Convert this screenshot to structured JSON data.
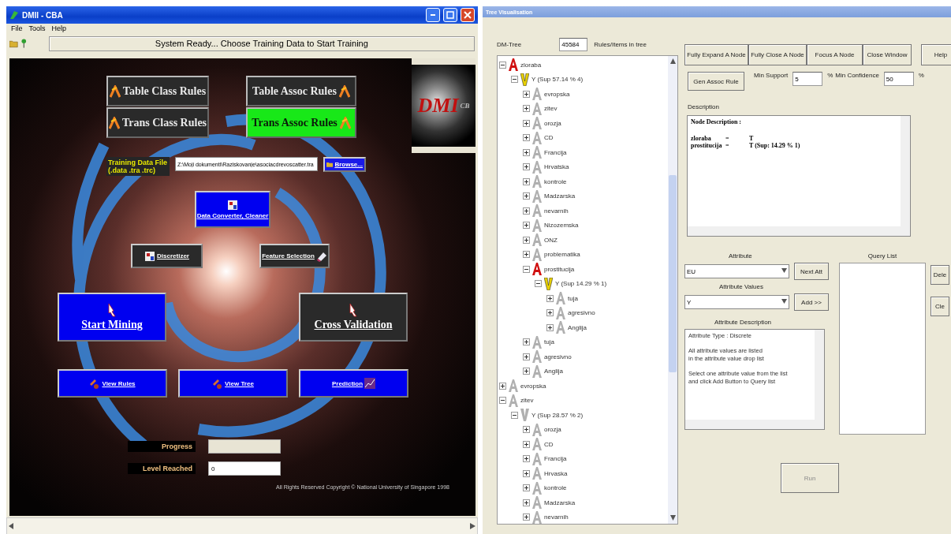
{
  "main_window": {
    "title": "DMII - CBA",
    "menu": [
      "File",
      "Tools",
      "Help"
    ],
    "status": "System Ready... Choose Training Data to Start Training",
    "logo": {
      "text": "DMI",
      "suffix": "CB"
    },
    "mode_buttons": [
      {
        "label": "Table Class Rules",
        "selected": false
      },
      {
        "label": "Table Assoc Rules",
        "selected": false
      },
      {
        "label": "Trans Class Rules",
        "selected": false
      },
      {
        "label": "Trans Assoc Rules",
        "selected": true
      }
    ],
    "training_file": {
      "label_lines": [
        "Training Data File",
        "(.data .tra .trc)"
      ],
      "path": "Z:\\Moji dokumenti\\Raziskovanje\\asociacdrevoscatter.tra",
      "browse": "Browse..."
    },
    "tool_buttons": [
      {
        "label": "Data Converter, Cleaner",
        "enabled": true
      },
      {
        "label": "Discretizer",
        "enabled": false
      },
      {
        "label": "Feature Selection",
        "enabled": false
      }
    ],
    "action_buttons": [
      {
        "label": "Start Mining",
        "enabled": true
      },
      {
        "label": "Cross Validation",
        "enabled": false
      }
    ],
    "view_buttons": [
      {
        "label": "View Rules",
        "enabled": true
      },
      {
        "label": "View Tree",
        "enabled": true
      },
      {
        "label": "Prediction",
        "enabled": true
      }
    ],
    "progress": {
      "label": "Progress",
      "level": 0
    },
    "level_reached": {
      "label": "Level Reached",
      "value": "0"
    },
    "copyright": "All Rights Reserved Copyright © National University of Singapore 1998"
  },
  "tree_window": {
    "title": "Tree Visualisation",
    "tree_label": "DM-Tree",
    "tree_count": "45584",
    "count_label": "Rules/Items in tree",
    "tree": [
      {
        "label": "zloraba",
        "kind": "attribute",
        "highlighted": true,
        "expanded": true,
        "children": [
          {
            "label": "Y (Sup 57.14 % 4)",
            "kind": "value",
            "highlighted": true,
            "expanded": true,
            "children": [
              {
                "label": "evropska",
                "kind": "attribute",
                "highlighted": false,
                "expanded": false
              },
              {
                "label": "zitev",
                "kind": "attribute",
                "highlighted": false,
                "expanded": false
              },
              {
                "label": "orozja",
                "kind": "attribute",
                "highlighted": false,
                "expanded": false
              },
              {
                "label": "CD",
                "kind": "attribute",
                "highlighted": false,
                "expanded": false
              },
              {
                "label": "Francija",
                "kind": "attribute",
                "highlighted": false,
                "expanded": false
              },
              {
                "label": "Hrvatska",
                "kind": "attribute",
                "highlighted": false,
                "expanded": false
              },
              {
                "label": "kontrole",
                "kind": "attribute",
                "highlighted": false,
                "expanded": false
              },
              {
                "label": "Madzarska",
                "kind": "attribute",
                "highlighted": false,
                "expanded": false
              },
              {
                "label": "nevarnih",
                "kind": "attribute",
                "highlighted": false,
                "expanded": false
              },
              {
                "label": "Nizozemska",
                "kind": "attribute",
                "highlighted": false,
                "expanded": false
              },
              {
                "label": "ONZ",
                "kind": "attribute",
                "highlighted": false,
                "expanded": false
              },
              {
                "label": "problematika",
                "kind": "attribute",
                "highlighted": false,
                "expanded": false
              },
              {
                "label": "prostitucija",
                "kind": "attribute",
                "highlighted": true,
                "expanded": true,
                "children": [
                  {
                    "label": "Y (Sup 14.29 % 1)",
                    "kind": "value",
                    "highlighted": true,
                    "expanded": true,
                    "children": [
                      {
                        "label": "tuja",
                        "kind": "attribute",
                        "highlighted": false,
                        "expanded": false
                      },
                      {
                        "label": "agresivno",
                        "kind": "attribute",
                        "highlighted": false,
                        "expanded": false
                      },
                      {
                        "label": "Anglija",
                        "kind": "attribute",
                        "highlighted": false,
                        "expanded": false
                      }
                    ]
                  }
                ]
              },
              {
                "label": "tuja",
                "kind": "attribute",
                "highlighted": false,
                "expanded": false
              },
              {
                "label": "agresivno",
                "kind": "attribute",
                "highlighted": false,
                "expanded": false
              },
              {
                "label": "Anglija",
                "kind": "attribute",
                "highlighted": false,
                "expanded": false
              }
            ]
          }
        ]
      },
      {
        "label": "evropska",
        "kind": "attribute",
        "highlighted": false,
        "expanded": false
      },
      {
        "label": "zitev",
        "kind": "attribute",
        "highlighted": false,
        "expanded": true,
        "children": [
          {
            "label": "Y (Sup 28.57 % 2)",
            "kind": "value",
            "highlighted": false,
            "expanded": true,
            "children": [
              {
                "label": "orozja",
                "kind": "attribute",
                "highlighted": false,
                "expanded": false
              },
              {
                "label": "CD",
                "kind": "attribute",
                "highlighted": false,
                "expanded": false
              },
              {
                "label": "Francija",
                "kind": "attribute",
                "highlighted": false,
                "expanded": false
              },
              {
                "label": "Hrvaska",
                "kind": "attribute",
                "highlighted": false,
                "expanded": false
              },
              {
                "label": "kontrole",
                "kind": "attribute",
                "highlighted": false,
                "expanded": false
              },
              {
                "label": "Madzarska",
                "kind": "attribute",
                "highlighted": false,
                "expanded": false
              },
              {
                "label": "nevarnih",
                "kind": "attribute",
                "highlighted": false,
                "expanded": false
              }
            ]
          }
        ]
      }
    ],
    "node_buttons": [
      "Fully Expand A Node",
      "Fully Close A Node",
      "Focus A Node",
      "Close Window"
    ],
    "help_button": "Help",
    "gen_button": "Gen Assoc Rule",
    "min_support": {
      "label": "Min Support",
      "value": "5",
      "unit": "%"
    },
    "min_confidence": {
      "label": "Min Confidence",
      "value": "50",
      "unit": "%"
    },
    "description": {
      "label": "Description",
      "heading": "Node Description :",
      "lines": [
        {
          "attribute": "zloraba",
          "sign": "=",
          "value": "T"
        },
        {
          "attribute": "prostitucija",
          "sign": "=",
          "value": "T (Sup: 14.29 % 1)"
        }
      ]
    },
    "attribute": {
      "label": "Attribute",
      "value": "EU",
      "button": "Next Att"
    },
    "attribute_values": {
      "label": "Attribute Values",
      "value": "Y",
      "button": "Add >>"
    },
    "attribute_description": {
      "label": "Attribute Description",
      "paragraphs": [
        [
          "Attribute Type : Discrete"
        ],
        [
          "All attribute values are listed",
          "in the attribute value drop list"
        ],
        [
          "Select one attribute value from the list",
          "and click Add Button to Query list"
        ]
      ]
    },
    "query_list": {
      "label": "Query List"
    },
    "side_buttons": [
      "Dele",
      "Cle"
    ],
    "run_button": {
      "label": "Run",
      "disabled": true
    }
  }
}
